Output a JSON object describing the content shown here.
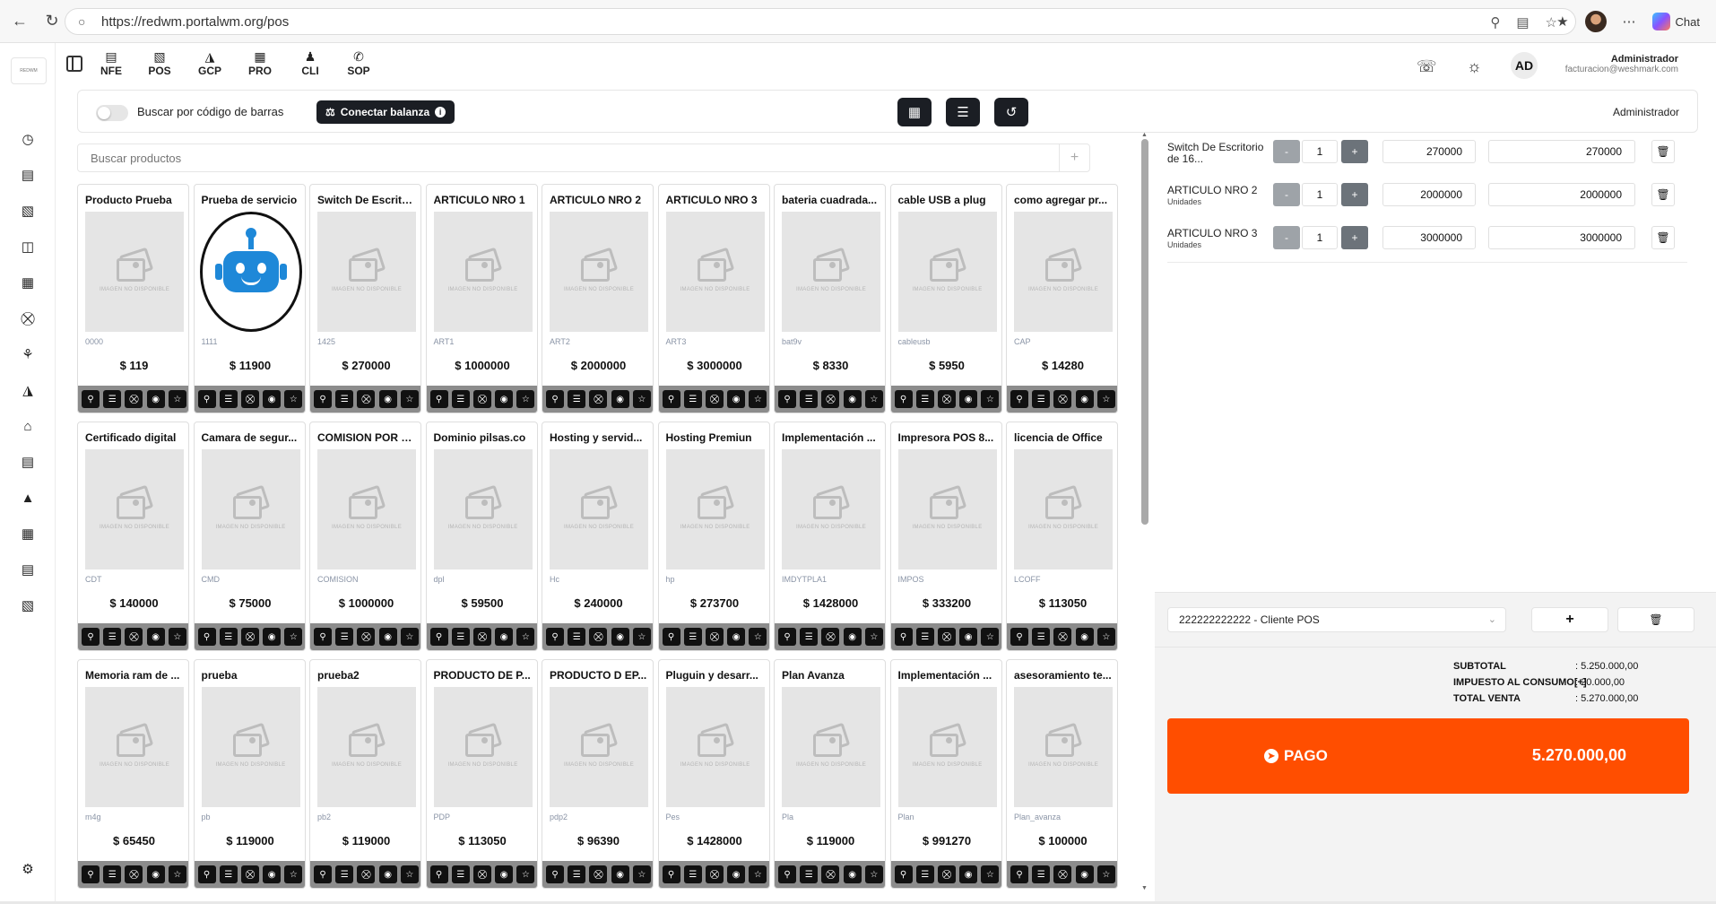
{
  "browser": {
    "url": "https://redwm.portalwm.org/pos",
    "chat_label": "Chat"
  },
  "sidebar": {
    "logo_text": "REDWM"
  },
  "modules": [
    {
      "label": "NFE",
      "icon": "document-icon"
    },
    {
      "label": "POS",
      "icon": "pos-icon"
    },
    {
      "label": "GCP",
      "icon": "bag-icon"
    },
    {
      "label": "PRO",
      "icon": "grid-icon"
    },
    {
      "label": "CLI",
      "icon": "users-icon"
    },
    {
      "label": "SOP",
      "icon": "whatsapp-icon"
    }
  ],
  "user": {
    "initials": "AD",
    "name": "Administrador",
    "email": "facturacion@weshmark.com"
  },
  "toolbar": {
    "barcode_label": "Buscar por código de barras",
    "scale_label": "Conectar balanza",
    "user_label": "Administrador"
  },
  "search": {
    "placeholder": "Buscar productos",
    "add": "+"
  },
  "image_unavailable": "IMAGEN NO DISPONIBLE",
  "products": [
    {
      "name": "Producto Prueba",
      "code": "0000",
      "price": "$ 119"
    },
    {
      "name": "Prueba de servicio",
      "code": "1111",
      "price": "$ 11900",
      "robot": true
    },
    {
      "name": "Switch De Escritorio de 16...",
      "code": "1425",
      "price": "$ 270000"
    },
    {
      "name": "ARTICULO NRO 1",
      "code": "ART1",
      "price": "$ 1000000"
    },
    {
      "name": "ARTICULO NRO 2",
      "code": "ART2",
      "price": "$ 2000000"
    },
    {
      "name": "ARTICULO NRO 3",
      "code": "ART3",
      "price": "$ 3000000"
    },
    {
      "name": "bateria cuadrada...",
      "code": "bat9v",
      "price": "$ 8330"
    },
    {
      "name": "cable USB a plug",
      "code": "cableusb",
      "price": "$ 5950"
    },
    {
      "name": "como agregar pr...",
      "code": "CAP",
      "price": "$ 14280"
    },
    {
      "name": "Certificado digital",
      "code": "CDT",
      "price": "$ 140000"
    },
    {
      "name": "Camara de segur...",
      "code": "CMD",
      "price": "$ 75000"
    },
    {
      "name": "COMISION POR S...",
      "code": "COMISION",
      "price": "$ 1000000"
    },
    {
      "name": "Dominio pilsas.co",
      "code": "dpl",
      "price": "$ 59500"
    },
    {
      "name": "Hosting y servid...",
      "code": "Hc",
      "price": "$ 240000"
    },
    {
      "name": "Hosting Premiun",
      "code": "hp",
      "price": "$ 273700"
    },
    {
      "name": "Implementación ...",
      "code": "IMDYTPLA1",
      "price": "$ 1428000"
    },
    {
      "name": "Impresora POS 8...",
      "code": "IMPOS",
      "price": "$ 333200"
    },
    {
      "name": "licencia de Office",
      "code": "LCOFF",
      "price": "$ 113050"
    },
    {
      "name": "Memoria ram de ...",
      "code": "m4g",
      "price": "$ 65450"
    },
    {
      "name": "prueba",
      "code": "pb",
      "price": "$ 119000"
    },
    {
      "name": "prueba2",
      "code": "pb2",
      "price": "$ 119000"
    },
    {
      "name": "PRODUCTO DE P...",
      "code": "PDP",
      "price": "$ 113050"
    },
    {
      "name": "PRODUCTO D EP...",
      "code": "pdp2",
      "price": "$ 96390"
    },
    {
      "name": "Pluguin y desarr...",
      "code": "Pes",
      "price": "$ 1428000"
    },
    {
      "name": "Plan Avanza",
      "code": "Pla",
      "price": "$ 119000"
    },
    {
      "name": "Implementación ...",
      "code": "Plan",
      "price": "$ 991270"
    },
    {
      "name": "asesoramiento te...",
      "code": "Plan_avanza",
      "price": "$ 100000"
    }
  ],
  "cart": [
    {
      "name": "Switch De Escritorio de 16...",
      "unit": "",
      "qty": "1",
      "price": "270000",
      "total": "270000"
    },
    {
      "name": "ARTICULO NRO 2",
      "unit": "Unidades",
      "qty": "1",
      "price": "2000000",
      "total": "2000000"
    },
    {
      "name": "ARTICULO NRO 3",
      "unit": "Unidades",
      "qty": "1",
      "price": "3000000",
      "total": "3000000"
    }
  ],
  "client": {
    "selected": "222222222222 - Cliente POS",
    "add": "+"
  },
  "totals": {
    "subtotal_label": "SUBTOTAL",
    "subtotal_value": ": 5.250.000,00",
    "tax_label": "IMPUESTO AL CONSUMO[+]",
    "tax_value": ": 20.000,00",
    "total_label": "TOTAL VENTA",
    "total_value": ": 5.270.000,00"
  },
  "payment": {
    "label": "PAGO",
    "amount": "5.270.000,00"
  },
  "colors": {
    "accent": "#ff4e00",
    "dark_button": "#1b1e24",
    "robot_blue": "#1e88d8"
  }
}
